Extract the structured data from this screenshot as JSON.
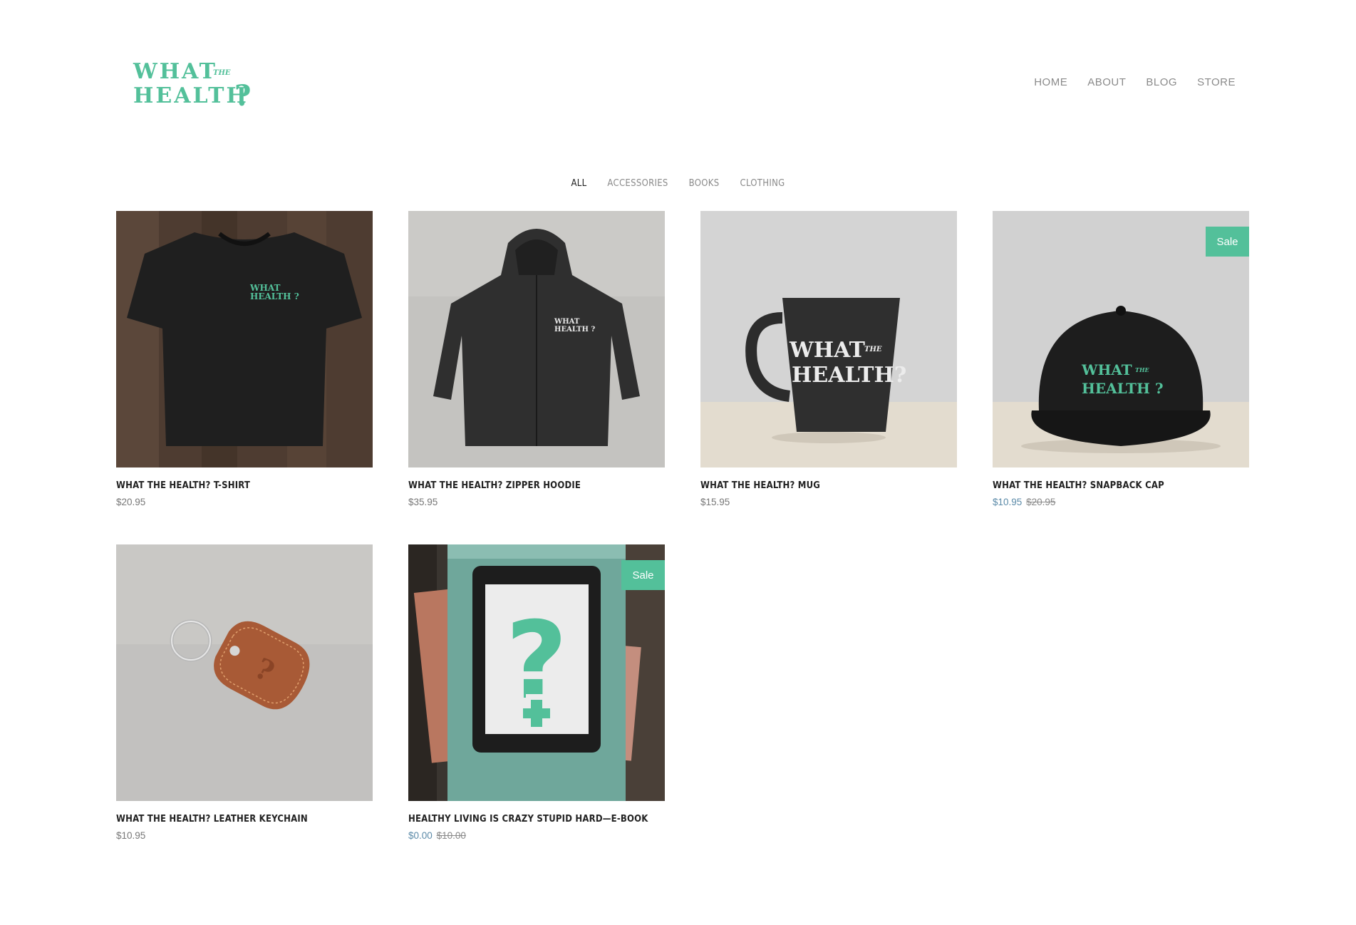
{
  "brand": {
    "line1": "WHAT",
    "the": "THE",
    "line2": "HEALTH",
    "mark": "?",
    "color": "#53c09a"
  },
  "nav": [
    {
      "label": "HOME"
    },
    {
      "label": "ABOUT"
    },
    {
      "label": "BLOG"
    },
    {
      "label": "STORE"
    }
  ],
  "categories": [
    {
      "label": "ALL",
      "active": true
    },
    {
      "label": "ACCESSORIES",
      "active": false
    },
    {
      "label": "BOOKS",
      "active": false
    },
    {
      "label": "CLOTHING",
      "active": false
    }
  ],
  "products": [
    {
      "name": "WHAT THE HEALTH? T-SHIRT",
      "price": "$20.95",
      "old_price": "",
      "sale": false,
      "icon": "t-shirt-image"
    },
    {
      "name": "WHAT THE HEALTH? ZIPPER HOODIE",
      "price": "$35.95",
      "old_price": "",
      "sale": false,
      "icon": "hoodie-image"
    },
    {
      "name": "WHAT THE HEALTH? MUG",
      "price": "$15.95",
      "old_price": "",
      "sale": false,
      "icon": "mug-image"
    },
    {
      "name": "WHAT THE HEALTH? SNAPBACK CAP",
      "price": "$10.95",
      "old_price": "$20.95",
      "sale": true,
      "sale_label": "Sale",
      "icon": "cap-image"
    },
    {
      "name": "WHAT THE HEALTH? LEATHER KEYCHAIN",
      "price": "$10.95",
      "old_price": "",
      "sale": false,
      "icon": "keychain-image"
    },
    {
      "name": "HEALTHY LIVING IS CRAZY STUPID HARD—E-BOOK",
      "price": "$0.00",
      "old_price": "$10.00",
      "sale": true,
      "sale_label": "Sale",
      "icon": "ebook-image"
    }
  ],
  "colors": {
    "accent": "#53c09a",
    "sale_price": "#5b8aa8",
    "muted": "#8a8a8a"
  }
}
